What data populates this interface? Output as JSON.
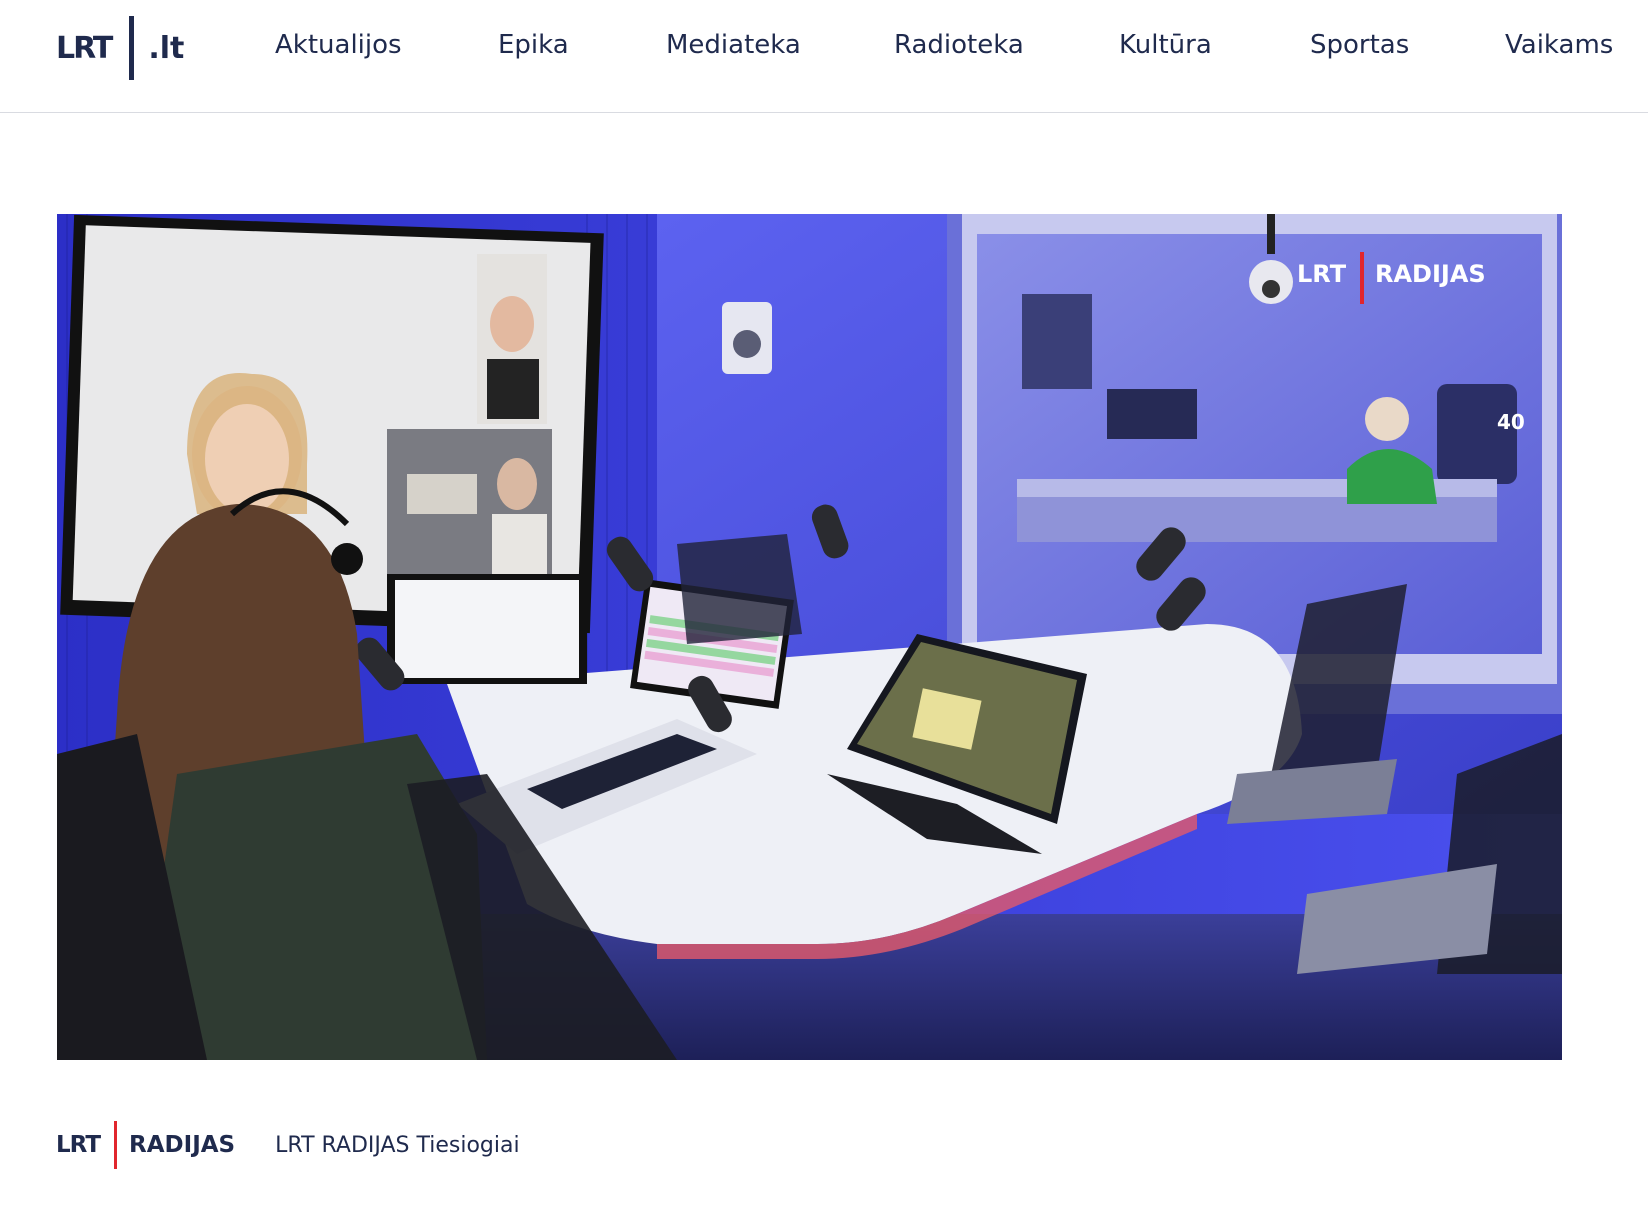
{
  "header": {
    "logo_mark": "LRT",
    "logo_suffix": ".lt",
    "nav": [
      {
        "label": "Aktualijos"
      },
      {
        "label": "Epika"
      },
      {
        "label": "Mediateka"
      },
      {
        "label": "Radioteka"
      },
      {
        "label": "Kultūra"
      },
      {
        "label": "Sportas"
      },
      {
        "label": "Vaikams"
      }
    ]
  },
  "video": {
    "overlay_logo_left": "LRT",
    "overlay_logo_right": "RADIJAS",
    "studio_sign": "40"
  },
  "player": {
    "logo_left": "LRT",
    "logo_right": "RADIJAS",
    "title": "LRT RADIJAS Tiesiogiai"
  },
  "colors": {
    "brand_text": "#1f2a4d",
    "brand_accent": "#e1262d",
    "studio_blue": "#3c3fe0"
  }
}
